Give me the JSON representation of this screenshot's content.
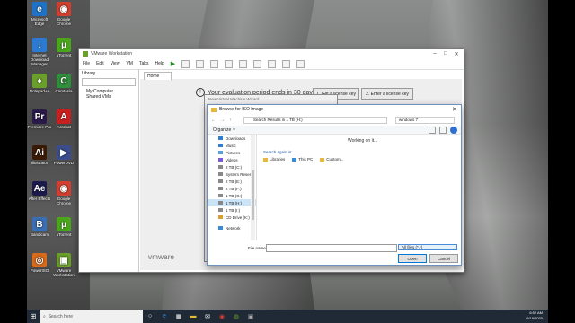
{
  "desktop_icons": [
    {
      "label": "Microsoft Edge",
      "glyph": "e",
      "color": "#1e73c8"
    },
    {
      "label": "Google Chrome",
      "glyph": "◉",
      "color": "#d23f31"
    },
    {
      "label": "Internet Download Manager",
      "glyph": "↓",
      "color": "#2b7bd3"
    },
    {
      "label": "uTorrent",
      "glyph": "µ",
      "color": "#4aa71b"
    },
    {
      "label": "Notepad++",
      "glyph": "♦",
      "color": "#6a9f2b"
    },
    {
      "label": "Camtasia",
      "glyph": "C",
      "color": "#2f8f3a"
    },
    {
      "label": "Premiere Pro",
      "glyph": "Pr",
      "color": "#2a1a4a"
    },
    {
      "label": "Acrobat",
      "glyph": "A",
      "color": "#c8201e"
    },
    {
      "label": "Illustrator",
      "glyph": "Ai",
      "color": "#3a1a06"
    },
    {
      "label": "PowerDVD",
      "glyph": "▶",
      "color": "#3b4d8c"
    },
    {
      "label": "After Effects",
      "glyph": "Ae",
      "color": "#1c1a4a"
    },
    {
      "label": "Google Chrome",
      "glyph": "◉",
      "color": "#d23f31"
    },
    {
      "label": "Bandicam",
      "glyph": "B",
      "color": "#3a6fb5"
    },
    {
      "label": "uTorrent",
      "glyph": "µ",
      "color": "#4aa71b"
    },
    {
      "label": "PowerISO",
      "glyph": "◎",
      "color": "#d86a1a"
    },
    {
      "label": "VMware Workstation",
      "glyph": "▣",
      "color": "#6a9f2b"
    }
  ],
  "vmware": {
    "title": "VMware Workstation",
    "menu": [
      "File",
      "Edit",
      "View",
      "VM",
      "Tabs",
      "Help"
    ],
    "library_header": "Library",
    "library_items": [
      "My Computer",
      "Shared VMs"
    ],
    "home_tab": "Home",
    "eval_text": "Your evaluation period ends in 30 days",
    "get_license": "1. Get a license key",
    "enter_license": "2. Enter a license key",
    "logo_text": "vmware"
  },
  "wizard": {
    "title": "New Virtual Machine Wizard"
  },
  "browse_dialog": {
    "title": "Browse for ISO Image",
    "address": "Search Results in 1 TB (H:)",
    "search_value": "windows 7",
    "organize": "Organize",
    "working_text": "Working on it...",
    "search_again": "Search again in:",
    "locations": [
      "Libraries",
      "This PC",
      "Custom..."
    ],
    "nav_items": [
      "Downloads",
      "Music",
      "Pictures",
      "Videos",
      "2 TB (C:)",
      "System Reserve",
      "2 TB (E:)",
      "2 TB (F:)",
      "1 TB (G:)",
      "1 TB (H:)",
      "1 TB (I:)",
      "CD Drive (K:)",
      "Network"
    ],
    "selected_nav": "1 TB (H:)",
    "file_name_label": "File name:",
    "file_name_value": "",
    "filter_value": "All files (*.*)",
    "open_label": "Open",
    "cancel_label": "Cancel"
  },
  "taskbar": {
    "search_placeholder": "Search here",
    "time": "6:52 AM",
    "date": "6/19/2020"
  }
}
